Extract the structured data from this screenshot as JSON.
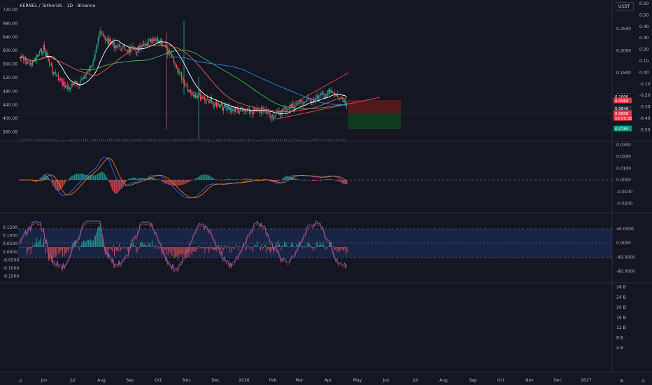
{
  "header": {
    "symbol_line": "KERNEL / TetherUS · 1D · Binance",
    "currency_button": "USDT"
  },
  "colors": {
    "background": "#131722",
    "up": "#26a69a",
    "down": "#ef5350",
    "ma_fast": "#ffffff",
    "ma_mid": "#ef5350",
    "ma_slow": "#1e88e5",
    "ma_long": "#4caf50",
    "trendline": "#f23645",
    "macd_line": "#2962ff",
    "signal_line": "#ff6d00",
    "rsi_band": "#1e2a52"
  },
  "main_pane": {
    "left_axis_labels": [
      "720.00",
      "680.00",
      "640.00",
      "600.00",
      "560.00",
      "520.00",
      "480.00",
      "440.00",
      "400.00",
      "360.00"
    ],
    "right_axis_labels": [
      "0.60",
      "0.50",
      "0.40",
      "0.30",
      "0.20",
      "0.10",
      "0.00",
      "-0.10",
      "-0.20",
      "-0.30",
      "-0.40",
      "-0.50"
    ],
    "right_axis_labels_inner": [
      "0.2500",
      "0.2000",
      "0.1500",
      "0.1000"
    ],
    "price_tags": [
      {
        "text": "0.1000",
        "color": "#131722",
        "text_color": "#b2b5be"
      },
      {
        "text": "0.0969",
        "color": "#f23645",
        "text_color": "#ffffff"
      },
      {
        "text": "0.0846",
        "color": "#2a2e39",
        "text_color": "#ffffff"
      },
      {
        "text": "0.0808",
        "color": "#f23645",
        "text_color": "#ffffff"
      },
      {
        "text": "16:55:32",
        "color": "#f23645",
        "text_color": "#ffffff"
      },
      {
        "text": "0.0785",
        "color": "#089981",
        "text_color": "#ffffff"
      }
    ],
    "position_tool": {
      "stop": "above",
      "target": "below"
    }
  },
  "macd_pane": {
    "axis_labels": [
      "0.0300",
      "0.0200",
      "0.0100",
      "0.0000",
      "-0.0100",
      "-0.0200"
    ]
  },
  "rsi_pane": {
    "left_axis_labels": [
      "0.1500",
      "0.1000",
      "0.0500",
      "0.0000",
      "-0.0500",
      "-0.1000",
      "-0.1500"
    ],
    "right_axis_labels": [
      "40.0000",
      "0.0000",
      "-40.0000",
      "-80.0000"
    ]
  },
  "volume_pane": {
    "axis_labels": [
      "28 B",
      "24 B",
      "20 B",
      "16 B",
      "12 B",
      "8 B",
      "4 B"
    ]
  },
  "time_axis": {
    "labels": [
      "Jun",
      "Jul",
      "Aug",
      "Sep",
      "Oct",
      "Nov",
      "Dec",
      "2026",
      "Feb",
      "Mar",
      "Apr",
      "May",
      "Jun",
      "Jul",
      "Aug",
      "Sep",
      "Oct",
      "Nov",
      "Dec",
      "2027"
    ]
  }
}
